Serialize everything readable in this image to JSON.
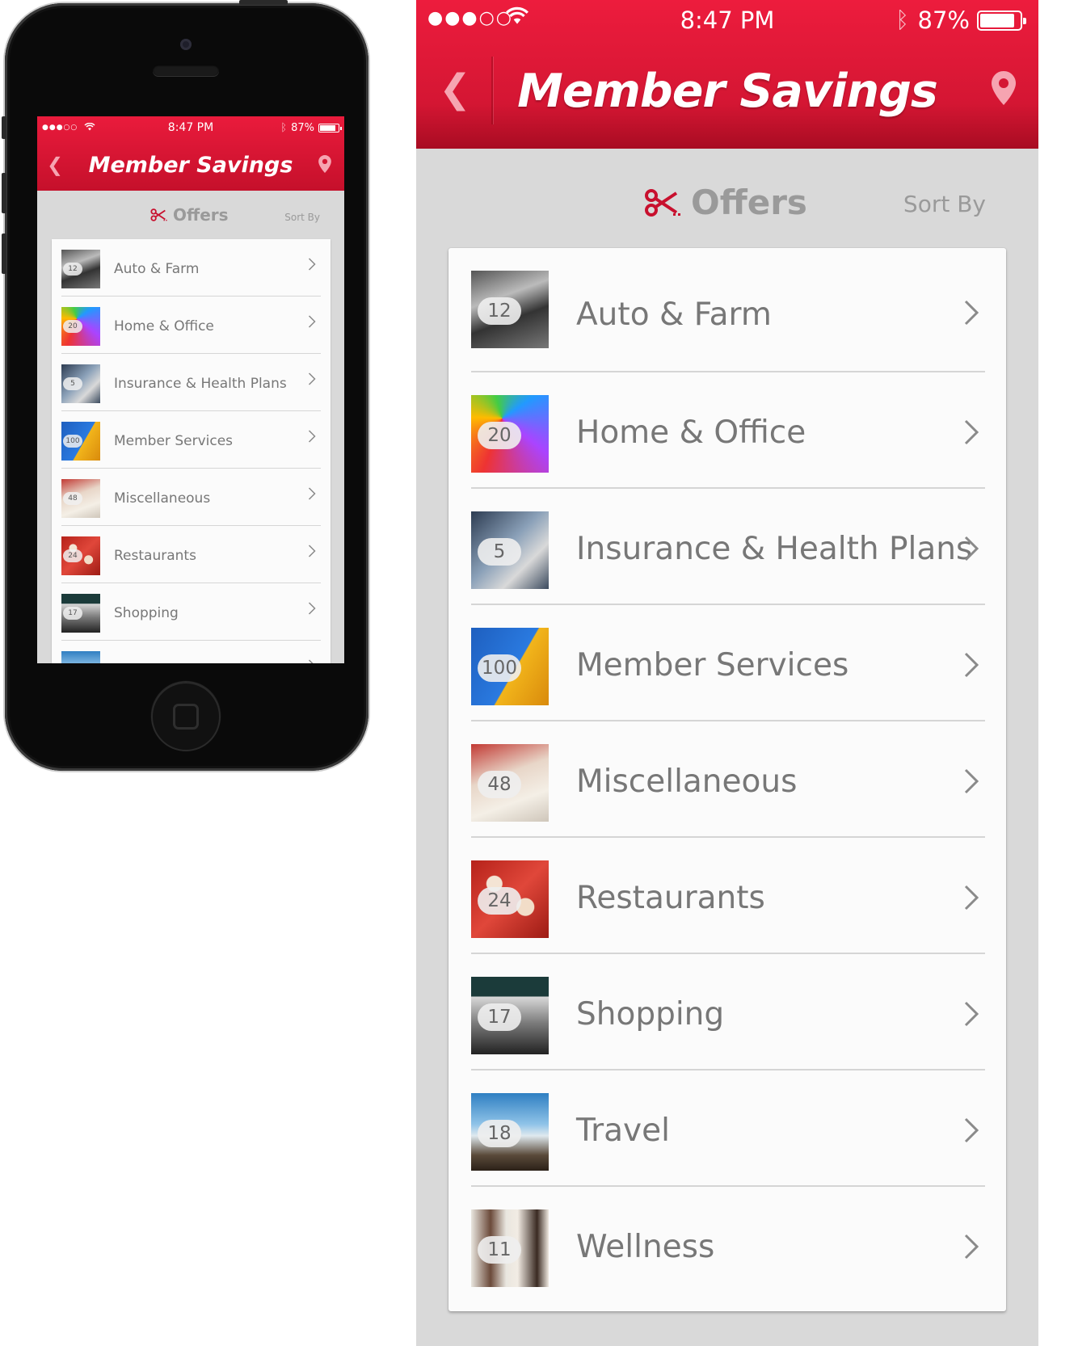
{
  "status_bar": {
    "signal": "●●●○○",
    "time": "8:47 PM",
    "battery_text": "87%",
    "battery_level": 0.87
  },
  "header": {
    "title": "Member Savings",
    "back_icon": "chevron-left-icon",
    "location_icon": "map-pin-icon"
  },
  "subbar": {
    "offers_label": "Offers",
    "offers_icon": "scissors-coupon-icon",
    "sort_label": "Sort By"
  },
  "categories": [
    {
      "label": "Auto & Farm",
      "count": "12"
    },
    {
      "label": "Home & Office",
      "count": "20"
    },
    {
      "label": "Insurance & Health Plans",
      "count": "5"
    },
    {
      "label": "Member Services",
      "count": "100"
    },
    {
      "label": "Miscellaneous",
      "count": "48"
    },
    {
      "label": "Restaurants",
      "count": "24"
    },
    {
      "label": "Shopping",
      "count": "17"
    },
    {
      "label": "Travel",
      "count": "18"
    },
    {
      "label": "Wellness",
      "count": "11"
    }
  ],
  "colors": {
    "brand_red": "#e31837",
    "background_gray": "#d9d9d9",
    "text_gray": "#777777"
  }
}
